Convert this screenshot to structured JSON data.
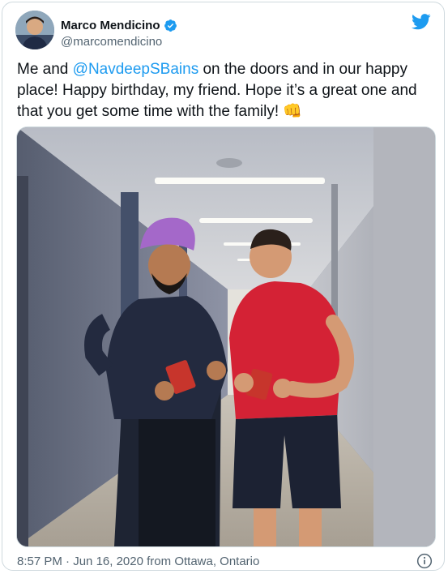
{
  "tweet": {
    "author": {
      "display_name": "Marco Mendicino",
      "handle": "@marcomendicino",
      "verified": true,
      "avatar_icon": "profile-photo"
    },
    "text_before": "Me and ",
    "mention": "@NavdeepSBains",
    "text_after": " on the doors and in our happy place! Happy birthday, my friend. Hope it’s a great one and that you get some time with the family! ",
    "emoji": "👊",
    "photo": {
      "description_icon": "hallway-photo"
    },
    "meta": {
      "time": "8:57 PM",
      "separator": " · ",
      "date": "Jun 16, 2020",
      "location_prefix": " from ",
      "location": "Ottawa, Ontario"
    }
  },
  "icons": {
    "brand": "twitter-bird-icon",
    "verified": "verified-badge-icon",
    "info": "info-icon"
  },
  "colors": {
    "brand_blue": "#1d9bf0",
    "text_primary": "#0f1419",
    "text_secondary": "#536471",
    "border": "#cfd9de"
  }
}
